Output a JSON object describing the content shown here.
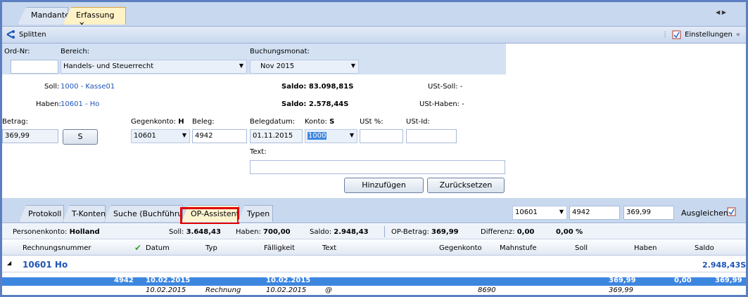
{
  "tabs": [
    {
      "label": "Mandanten"
    },
    {
      "label": "Erfassung",
      "close": "✕"
    }
  ],
  "tab_scroll": "◀ ▶",
  "toolbar": {
    "split_label": "Splitten",
    "settings_label": "Einstellungen",
    "collapse": "«"
  },
  "form": {
    "ord_nr_label": "Ord-Nr:",
    "ord_nr_value": "",
    "bereich_label": "Bereich:",
    "bereich_value": "Handels- und Steuerrecht",
    "monat_label": "Buchungsmonat:",
    "monat_value": "Nov 2015",
    "soll_label": "Soll:",
    "soll_value": "1000 - Kasse01",
    "saldo_soll": "Saldo: 83.098,81S",
    "ust_soll": "USt-Soll: -",
    "haben_label": "Haben:",
    "haben_value": "10601 - Ho",
    "saldo_haben": "Saldo: 2.578,44S",
    "ust_haben": "USt-Haben: -",
    "betrag_label": "Betrag:",
    "betrag_value": "369,99",
    "s_button": "S",
    "gegenkonto_label": "Gegenkonto:",
    "gegenkonto_side": "H",
    "gegenkonto_value": "10601",
    "beleg_label": "Beleg:",
    "beleg_value": "4942",
    "belegdatum_label": "Belegdatum:",
    "belegdatum_value": "01.11.2015",
    "konto_label": "Konto:",
    "konto_side": "S",
    "konto_value": "1000",
    "ust_pct_label": "USt %:",
    "ustid_label": "USt-Id:",
    "text_label": "Text:",
    "text_value": "",
    "add_button": "Hinzufügen",
    "reset_button": "Zurücksetzen"
  },
  "lower_tabs": [
    "Protokoll",
    "T-Konten",
    "Suche (Buchführung)",
    "OP-Assistent",
    "Typen"
  ],
  "lower_tools": {
    "konto": "10601",
    "beleg": "4942",
    "betrag": "369,99",
    "ausgleichen": "Ausgleichen"
  },
  "summary": {
    "personenkonto_label": "Personenkonto:",
    "personenkonto_value": "Holland",
    "soll_label": "Soll:",
    "soll_value": "3.648,43",
    "haben_label": "Haben:",
    "haben_value": "700,00",
    "saldo_label": "Saldo:",
    "saldo_value": "2.948,43",
    "op_label": "OP-Betrag:",
    "op_value": "369,99",
    "diff_label": "Differenz:",
    "diff_value": "0,00",
    "pct": "0,00 %"
  },
  "columns": [
    "Rechnungsnummer",
    "Datum",
    "Typ",
    "Fälligkeit",
    "Text",
    "Gegenkonto",
    "Mahnstufe",
    "Soll",
    "Haben",
    "Saldo"
  ],
  "group": {
    "label": "10601 Ho",
    "saldo": "2.948,43S"
  },
  "rows": [
    {
      "nr": "4942",
      "datum": "10.02.2015",
      "faellig": "10.02.2015",
      "soll": "369,99",
      "haben": "0,00",
      "saldo": "369,99"
    },
    {
      "datum": "10.02.2015",
      "typ": "Rechnung",
      "faellig": "10.02.2015",
      "text": "@",
      "gegenkonto": "8690",
      "soll": "369,99"
    }
  ],
  "colors": {
    "accent": "#1d55b7",
    "highlight": "#e10000",
    "selected_row": "#3d86e0"
  }
}
